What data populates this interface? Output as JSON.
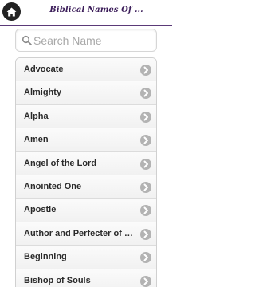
{
  "header": {
    "title": "Biblical Names Of ..."
  },
  "search": {
    "placeholder": "Search Name",
    "value": ""
  },
  "list": {
    "items": [
      {
        "label": "Advocate"
      },
      {
        "label": "Almighty"
      },
      {
        "label": "Alpha"
      },
      {
        "label": "Amen"
      },
      {
        "label": "Angel of the Lord"
      },
      {
        "label": "Anointed One"
      },
      {
        "label": "Apostle"
      },
      {
        "label": "Author and Perfecter of ou..."
      },
      {
        "label": "Beginning"
      },
      {
        "label": "Bishop of Souls"
      }
    ]
  },
  "icons": {
    "home": "home-icon",
    "search": "search-icon",
    "chevron": "chevron-right-icon"
  },
  "colors": {
    "title": "#3c1e5a",
    "divider": "#5b3a78",
    "home_button": "#222222",
    "chevron_circle": "#b3b3b3"
  }
}
